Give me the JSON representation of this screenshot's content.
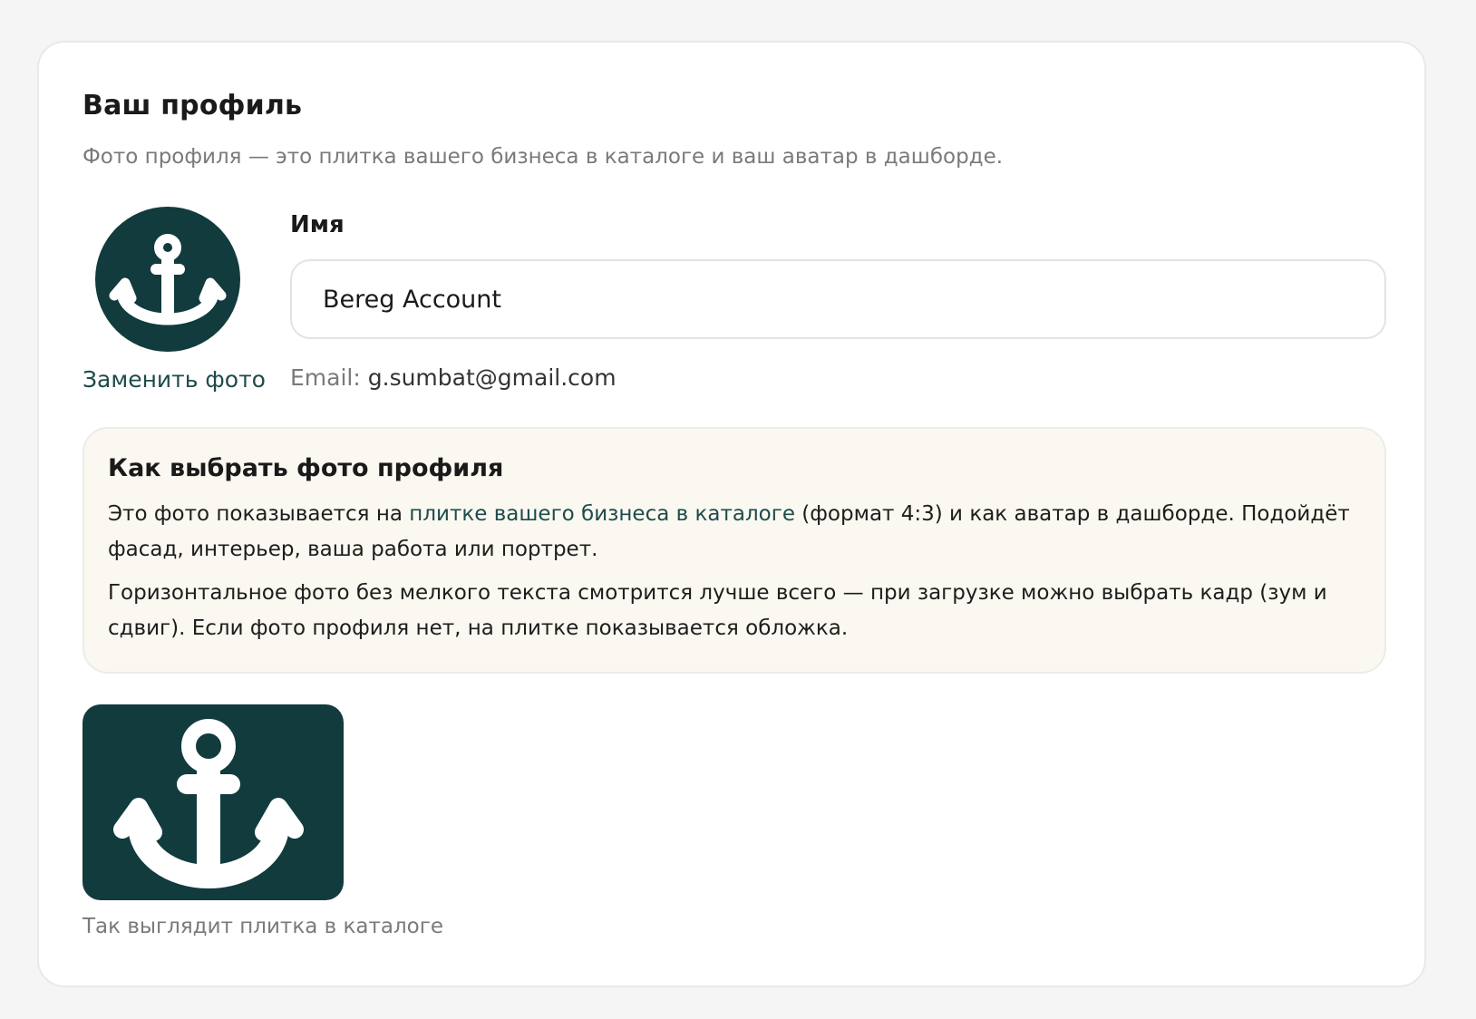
{
  "profile": {
    "title": "Ваш профиль",
    "subtitle": "Фото профиля — это плитка вашего бизнеса в каталоге и ваш аватар в дашборде.",
    "avatar_icon": "anchor-icon",
    "change_photo_label": "Заменить фото",
    "name_label": "Имя",
    "name_value": "Bereg Account",
    "email_label": "Email:",
    "email_value": "g.sumbat@gmail.com"
  },
  "tip": {
    "title": "Как выбрать фото профиля",
    "p1_before": "Это фото показывается на ",
    "p1_link": "плитке вашего бизнеса в каталоге",
    "p1_after": " (формат 4:3) и как аватар в дашборде. Подойдёт фасад, интерьер, ваша работа или портрет.",
    "p2": "Горизонтальное фото без мелкого текста смотрится лучше всего — при загрузке можно выбрать кадр (зум и сдвиг). Если фото профиля нет, на плитке показывается обложка."
  },
  "tile": {
    "icon": "anchor-icon",
    "caption": "Так выглядит плитка в каталоге"
  },
  "colors": {
    "brand": "#123b3e",
    "link": "#1e4b4c",
    "tip_background": "#faf8f0",
    "muted_text": "#7a7a7a"
  }
}
